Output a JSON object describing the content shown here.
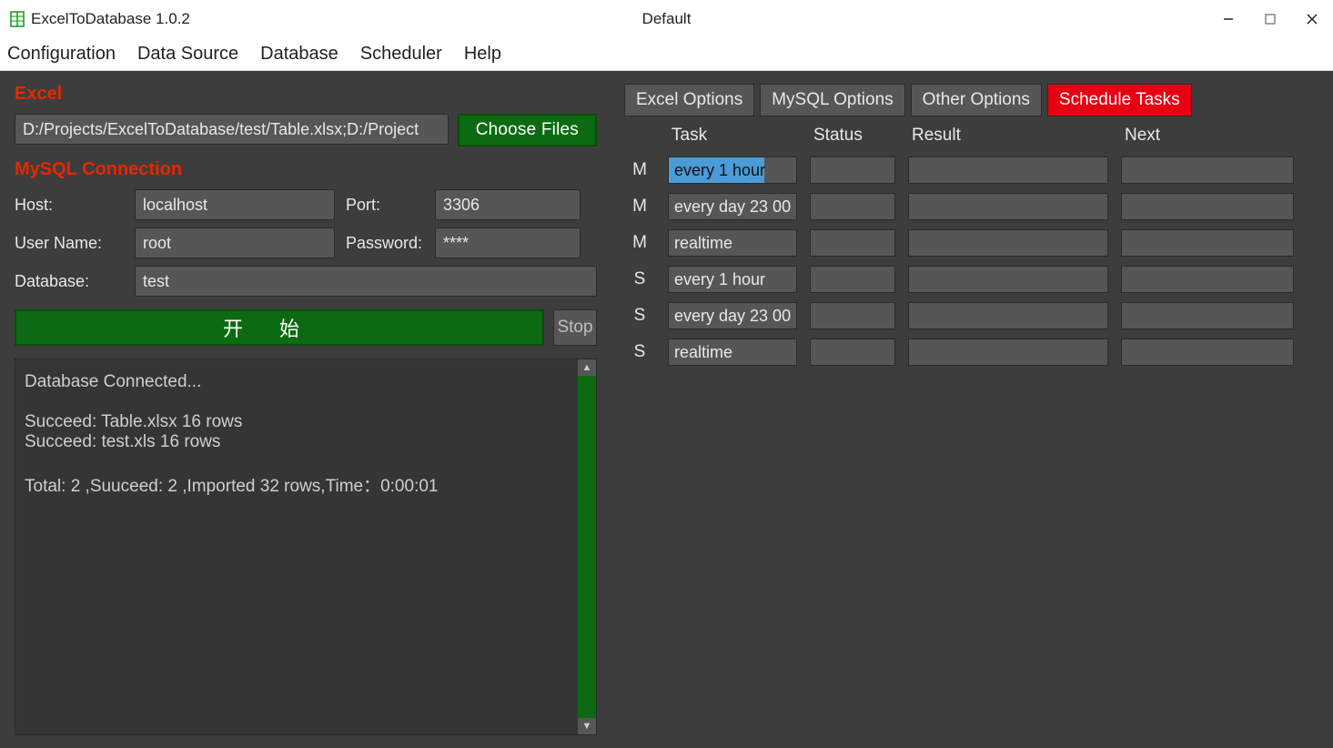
{
  "titlebar": {
    "app_title": "ExcelToDatabase 1.0.2",
    "center_title": "Default"
  },
  "menubar": {
    "items": [
      "Configuration",
      "Data Source",
      "Database",
      "Scheduler",
      "Help"
    ]
  },
  "left": {
    "excel_label": "Excel",
    "file_path": "D:/Projects/ExcelToDatabase/test/Table.xlsx;D:/Project",
    "choose_files_label": "Choose Files",
    "mysql_label": "MySQL Connection",
    "host_label": "Host:",
    "host_value": "localhost",
    "port_label": "Port:",
    "port_value": "3306",
    "user_label": "User Name:",
    "user_value": "root",
    "password_label": "Password:",
    "password_value": "****",
    "database_label": "Database:",
    "database_value": "test",
    "start_label": "开始",
    "stop_label": "Stop",
    "log_text": "Database Connected...\n\nSucceed: Table.xlsx 16 rows\nSucceed: test.xls 16 rows\n\nTotal: 2 ,Suuceed: 2 ,Imported 32 rows,Time：0:00:01"
  },
  "right": {
    "tabs": {
      "excel_options": "Excel Options",
      "mysql_options": "MySQL Options",
      "other_options": "Other Options",
      "schedule_tasks": "Schedule Tasks"
    },
    "headers": {
      "task": "Task",
      "status": "Status",
      "result": "Result",
      "next": "Next"
    },
    "rows": [
      {
        "label": "M",
        "task": "every 1 hour",
        "status": "",
        "result": "",
        "next": "",
        "selected": true
      },
      {
        "label": "M",
        "task": "every day 23 00",
        "status": "",
        "result": "",
        "next": "",
        "selected": false
      },
      {
        "label": "M",
        "task": "realtime",
        "status": "",
        "result": "",
        "next": "",
        "selected": false
      },
      {
        "label": "S",
        "task": "every 1 hour",
        "status": "",
        "result": "",
        "next": "",
        "selected": false
      },
      {
        "label": "S",
        "task": "every day 23 00",
        "status": "",
        "result": "",
        "next": "",
        "selected": false
      },
      {
        "label": "S",
        "task": "realtime",
        "status": "",
        "result": "",
        "next": "",
        "selected": false
      }
    ]
  }
}
